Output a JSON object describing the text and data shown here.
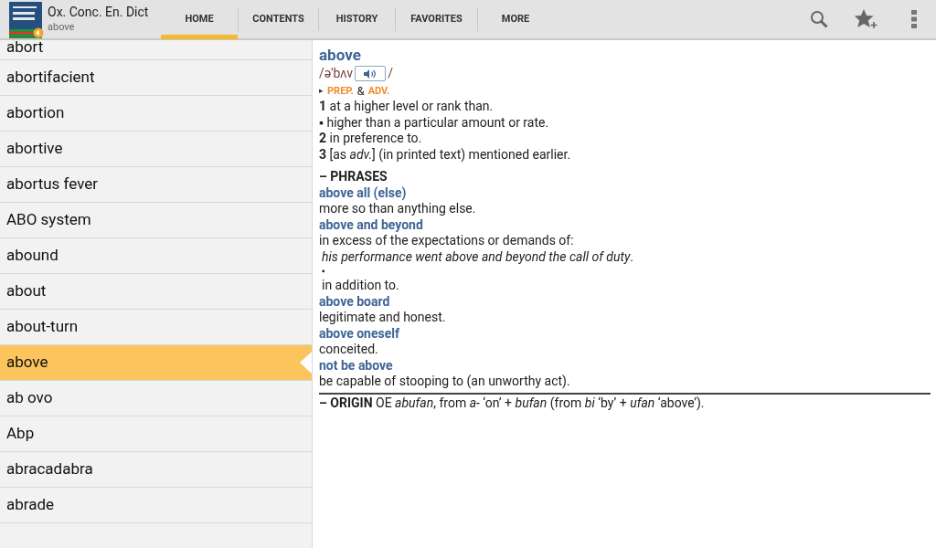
{
  "app": {
    "title": "Ox. Conc. En. Dict",
    "subtitle": "above"
  },
  "tabs": [
    {
      "label": "HOME",
      "selected": true
    },
    {
      "label": "CONTENTS",
      "selected": false
    },
    {
      "label": "HISTORY",
      "selected": false
    },
    {
      "label": "FAVORITES",
      "selected": false
    },
    {
      "label": "MORE",
      "selected": false
    }
  ],
  "word_list": [
    {
      "word": "abort",
      "selected": false
    },
    {
      "word": "abortifacient",
      "selected": false
    },
    {
      "word": "abortion",
      "selected": false
    },
    {
      "word": "abortive",
      "selected": false
    },
    {
      "word": "abortus fever",
      "selected": false
    },
    {
      "word": "ABO system",
      "selected": false
    },
    {
      "word": "abound",
      "selected": false
    },
    {
      "word": "about",
      "selected": false
    },
    {
      "word": "about-turn",
      "selected": false
    },
    {
      "word": "above",
      "selected": true
    },
    {
      "word": "ab ovo",
      "selected": false
    },
    {
      "word": "Abp",
      "selected": false
    },
    {
      "word": "abracadabra",
      "selected": false
    },
    {
      "word": "abrade",
      "selected": false
    }
  ],
  "entry": {
    "headword": "above",
    "pronunciation": "/ə'bʌv",
    "pronunciation_end": "/",
    "pos_marker": "▸",
    "pos_parts": [
      {
        "text": "PREP.",
        "kind": "pos"
      },
      {
        "text": "&",
        "kind": "plain"
      },
      {
        "text": "ADV.",
        "kind": "pos"
      }
    ],
    "senses": [
      "**1** at a higher level or rank than.",
      "▪ higher than a particular amount or rate.",
      "**2** in preference to.",
      "**3** [as *adv.*] (in printed text) mentioned earlier."
    ],
    "phrases_heading": "– PHRASES",
    "phrases": [
      {
        "phrase": "above all (else)",
        "lines": [
          {
            "kind": "def",
            "text": "more so than anything else."
          }
        ]
      },
      {
        "phrase": "above and beyond",
        "lines": [
          {
            "kind": "def",
            "text": "in excess of the expectations or demands of:"
          },
          {
            "kind": "example",
            "text": "his performance went above and beyond the call of duty",
            "end": "."
          },
          {
            "kind": "bullet",
            "text": "▪"
          },
          {
            "kind": "indent",
            "text": "in addition to."
          }
        ]
      },
      {
        "phrase": "above board",
        "lines": [
          {
            "kind": "def",
            "text": "legitimate and honest."
          }
        ]
      },
      {
        "phrase": "above oneself",
        "lines": [
          {
            "kind": "def",
            "text": "conceited."
          }
        ]
      },
      {
        "phrase": "not be above",
        "lines": [
          {
            "kind": "def",
            "text": "be capable of stooping to (an unworthy act)."
          }
        ]
      }
    ],
    "origin": "**– ORIGIN** OE *abufan*, from *a-* ‘on’ + *bufan* (from *bi* ‘by’ + *ufan* ‘above’)."
  }
}
